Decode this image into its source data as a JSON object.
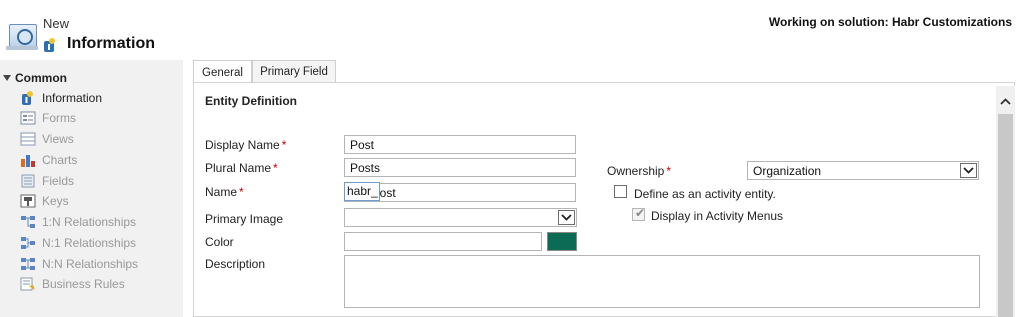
{
  "header": {
    "new_label": "New",
    "title": "Information",
    "solution_text": "Working on solution: Habr Customizations"
  },
  "nav": {
    "group_label": "Common",
    "items": [
      {
        "label": "Information",
        "icon": "info-icon",
        "active": true
      },
      {
        "label": "Forms",
        "icon": "forms-icon",
        "active": false
      },
      {
        "label": "Views",
        "icon": "views-icon",
        "active": false
      },
      {
        "label": "Charts",
        "icon": "charts-icon",
        "active": false
      },
      {
        "label": "Fields",
        "icon": "fields-icon",
        "active": false
      },
      {
        "label": "Keys",
        "icon": "keys-icon",
        "active": false
      },
      {
        "label": "1:N Relationships",
        "icon": "relationship-icon",
        "active": false
      },
      {
        "label": "N:1 Relationships",
        "icon": "relationship-icon",
        "active": false
      },
      {
        "label": "N:N Relationships",
        "icon": "relationship-icon",
        "active": false
      },
      {
        "label": "Business Rules",
        "icon": "business-rules-icon",
        "active": false
      }
    ]
  },
  "tabs": [
    {
      "label": "General",
      "active": true
    },
    {
      "label": "Primary Field",
      "active": false
    }
  ],
  "form": {
    "section_title": "Entity Definition",
    "display_name": {
      "label": "Display Name",
      "value": "Post",
      "required": true
    },
    "plural_name": {
      "label": "Plural Name",
      "value": "Posts",
      "required": true
    },
    "name": {
      "label": "Name",
      "prefix": "habr_",
      "value": "post",
      "required": true
    },
    "primary_image": {
      "label": "Primary Image",
      "value": ""
    },
    "color": {
      "label": "Color",
      "value": "",
      "swatch": "#0b6b55"
    },
    "description": {
      "label": "Description",
      "value": ""
    },
    "ownership": {
      "label": "Ownership",
      "value": "Organization",
      "required": true
    },
    "activity_entity": {
      "label": "Define as an activity entity.",
      "checked": false
    },
    "activity_menus": {
      "label": "Display in Activity Menus",
      "checked": true,
      "disabled": true
    }
  },
  "required_mark": "*"
}
